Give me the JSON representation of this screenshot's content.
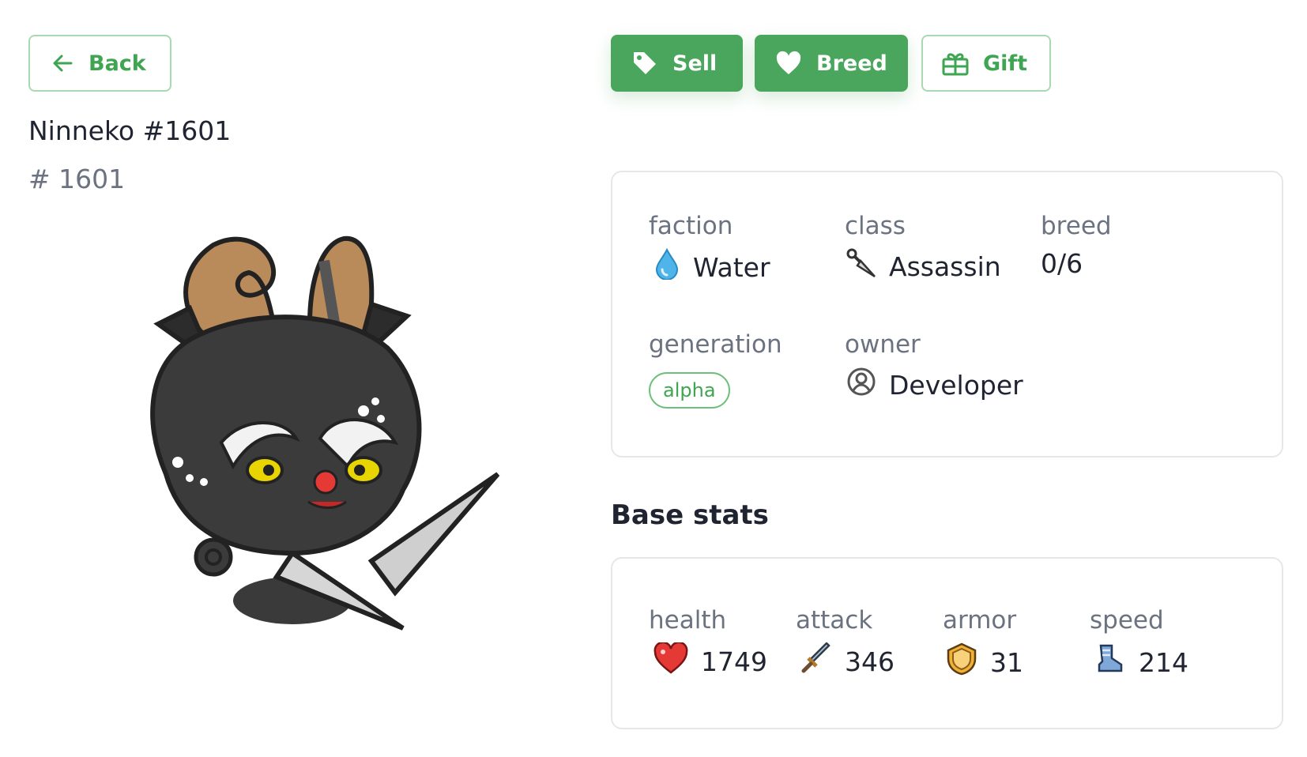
{
  "nav": {
    "back_label": "Back",
    "back_icon": "arrow-left-icon"
  },
  "actions": {
    "sell_label": "Sell",
    "sell_icon": "tag-icon",
    "breed_label": "Breed",
    "breed_icon": "heart-icon",
    "gift_label": "Gift",
    "gift_icon": "gift-icon"
  },
  "pet": {
    "name": "Ninneko #1601",
    "id_text": "# 1601"
  },
  "info": {
    "faction_label": "faction",
    "faction_value": "Water",
    "faction_icon": "water-drop-icon",
    "class_label": "class",
    "class_value": "Assassin",
    "class_icon": "kunai-icon",
    "breed_label": "breed",
    "breed_value": "0/6",
    "generation_label": "generation",
    "generation_value": "alpha",
    "owner_label": "owner",
    "owner_value": "Developer",
    "owner_icon": "user-circle-icon"
  },
  "base_stats": {
    "title": "Base stats",
    "health_label": "health",
    "health_value": "1749",
    "health_icon": "heart-icon",
    "attack_label": "attack",
    "attack_value": "346",
    "attack_icon": "sword-icon",
    "armor_label": "armor",
    "armor_value": "31",
    "armor_icon": "shield-icon",
    "speed_label": "speed",
    "speed_value": "214",
    "speed_icon": "boot-icon"
  },
  "colors": {
    "accent": "#4aa65c",
    "accent_border": "#a9d9b3",
    "muted_text": "#6b7280",
    "border": "#e5e7eb"
  }
}
